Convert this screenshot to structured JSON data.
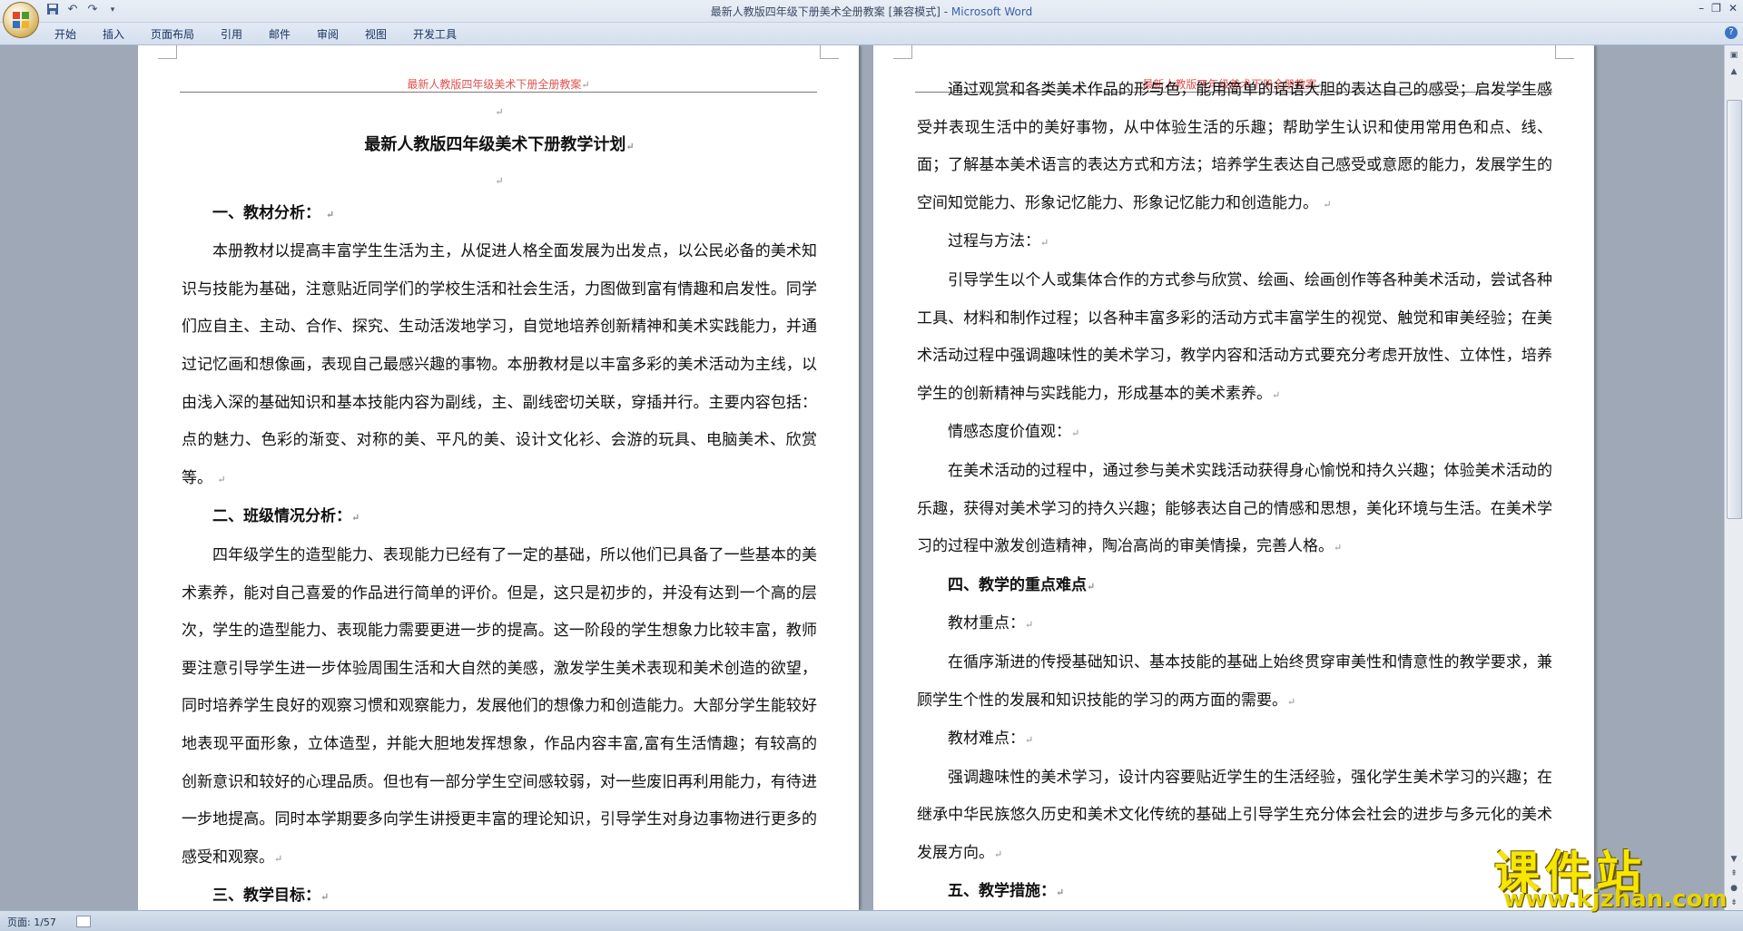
{
  "window": {
    "title": "最新人教版四年级下册美术全册教案 [兼容模式] - ",
    "app_name": "Microsoft Word"
  },
  "quick_access": {
    "save_icon": "save-icon",
    "undo_icon": "undo-icon",
    "redo_icon": "redo-icon",
    "customize_icon": "dropdown-icon"
  },
  "ribbon": {
    "tabs": [
      "开始",
      "插入",
      "页面布局",
      "引用",
      "邮件",
      "审阅",
      "视图",
      "开发工具"
    ]
  },
  "page_left": {
    "header": "最新人教版四年级美术下册全册教案",
    "title": "最新人教版四年级美术下册教学计划",
    "h1": "一、教材分析：",
    "p1": "本册教材以提高丰富学生生活为主，从促进人格全面发展为出发点，以公民必备的美术知识与技能为基础，注意贴近同学们的学校生活和社会生活，力图做到富有情趣和启发性。同学们应自主、主动、合作、探究、生动活泼地学习，自觉地培养创新精神和美术实践能力，并通过记忆画和想像画，表现自己最感兴趣的事物。本册教材是以丰富多彩的美术活动为主线，以由浅入深的基础知识和基本技能内容为副线，主、副线密切关联，穿插并行。主要内容包括：点的魅力、色彩的渐变、对称的美、平凡的美、设计文化衫、会游的玩具、电脑美术、欣赏等。",
    "h2": "二、班级情况分析：",
    "p2": "四年级学生的造型能力、表现能力已经有了一定的基础，所以他们已具备了一些基本的美术素养，能对自己喜爱的作品进行简单的评价。但是，这只是初步的，并没有达到一个高的层次，学生的造型能力、表现能力需要更进一步的提高。这一阶段的学生想象力比较丰富，教师要注意引导学生进一步体验周围生活和大自然的美感，激发学生美术表现和美术创造的欲望，同时培养学生良好的观察习惯和观察能力，发展他们的想像力和创造能力。大部分学生能较好地表现平面形象，立体造型，并能大胆地发挥想象，作品内容丰富,富有生活情趣；有较高的创新意识和较好的心理品质。但也有一部分学生空间感较弱，对一些废旧再利用能力，有待进一步地提高。同时本学期要多向学生讲授更丰富的理论知识，引导学生对身边事物进行更多的感受和观察。",
    "h3": "三、教学目标："
  },
  "page_right": {
    "header": "最新人教版四年级美术下册全册教案",
    "p1": "通过观赏和各类美术作品的形与色，能用简单的话语大胆的表达自己的感受；启发学生感受并表现生活中的美好事物，从中体验生活的乐趣；帮助学生认识和使用常用色和点、线、面；了解基本美术语言的表达方式和方法；培养学生表达自己感受或意愿的能力，发展学生的空间知觉能力、形象记忆能力、形象记忆能力和创造能力。",
    "l1": "过程与方法：",
    "p2": "引导学生以个人或集体合作的方式参与欣赏、绘画、绘画创作等各种美术活动，尝试各种工具、材料和制作过程；以各种丰富多彩的活动方式丰富学生的视觉、触觉和审美经验；在美术活动过程中强调趣味性的美术学习，教学内容和活动方式要充分考虑开放性、立体性，培养学生的创新精神与实践能力，形成基本的美术素养。",
    "l2": "情感态度价值观：",
    "p3": "在美术活动的过程中，通过参与美术实践活动获得身心愉悦和持久兴趣；体验美术活动的乐趣，获得对美术学习的持久兴趣；能够表达自己的情感和思想，美化环境与生活。在美术学习的过程中激发创造精神，陶冶高尚的审美情操，完善人格。",
    "h4": "四、教学的重点难点",
    "l3": "教材重点：",
    "p4": "在循序渐进的传授基础知识、基本技能的基础上始终贯穿审美性和情意性的教学要求，兼顾学生个性的发展和知识技能的学习的两方面的需要。",
    "l4": "教材难点：",
    "p5": "强调趣味性的美术学习，设计内容要贴近学生的生活经验，强化学生美术学习的兴趣；在继承中华民族悠久历史和美术文化传统的基础上引导学生充分体会社会的进步与多元化的美术发展方向。",
    "h5": "五、教学措施："
  },
  "paragraph_mark": "↵",
  "status": {
    "page": "页面: 1/57"
  },
  "watermark": {
    "text": "课件站",
    "url": "www.kjzhan.com"
  }
}
